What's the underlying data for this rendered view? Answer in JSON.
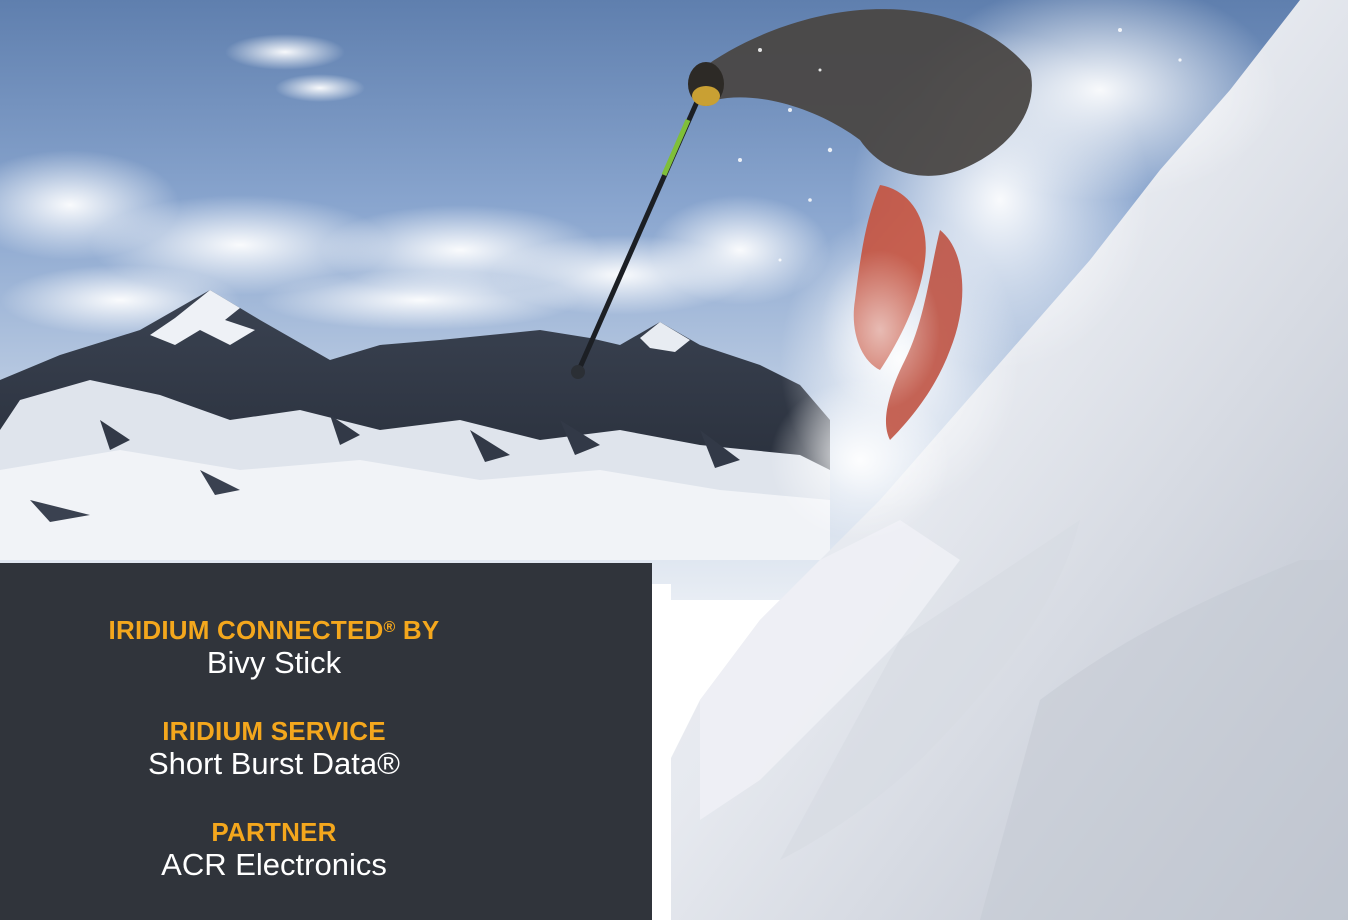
{
  "info": {
    "connected_by_label": "IRIDIUM CONNECTED",
    "connected_by_mark": "®",
    "connected_by_suffix": " BY",
    "connected_by_value": "Bivy Stick",
    "service_label": "IRIDIUM SERVICE",
    "service_value": "Short Burst Data®",
    "partner_label": "PARTNER",
    "partner_value": "ACR Electronics"
  },
  "colors": {
    "panel_background": "#30343b",
    "label_accent": "#f4a71d",
    "value_text": "#ffffff"
  }
}
